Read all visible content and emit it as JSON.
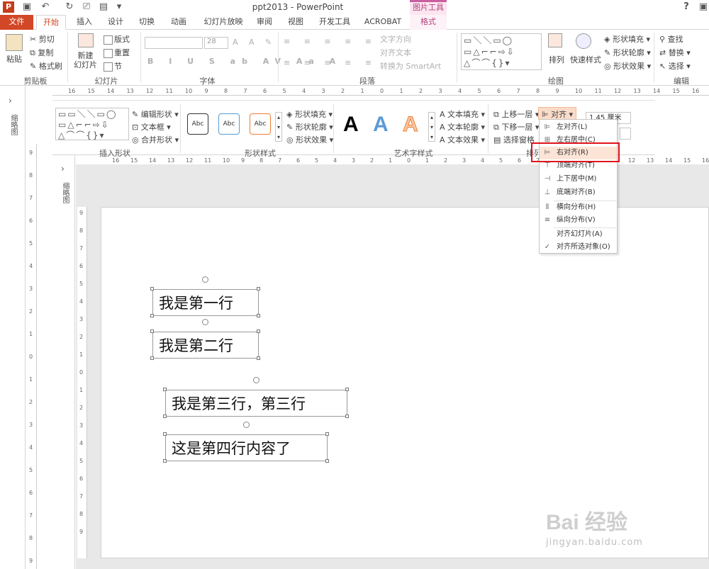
{
  "title_bar": {
    "title": "ppt2013 - PowerPoint",
    "contextual_group": "图片工具",
    "help": "?"
  },
  "tabs": [
    "文件",
    "开始",
    "插入",
    "设计",
    "切换",
    "动画",
    "幻灯片放映",
    "审阅",
    "视图",
    "开发工具",
    "ACROBAT",
    "格式"
  ],
  "ribbon_home": {
    "clipboard": {
      "paste": "粘贴",
      "cut": "剪切",
      "copy": "复制",
      "format_painter": "格式刷",
      "label": "剪贴板"
    },
    "slides": {
      "new_slide": "新建\n幻灯片",
      "layout": "版式",
      "reset": "重置",
      "section": "节",
      "label": "幻灯片"
    },
    "font": {
      "size": "28",
      "label": "字体"
    },
    "paragraph": {
      "text_direction": "文字方向",
      "align_text": "对齐文本",
      "smartart": "转换为 SmartArt",
      "label": "段落"
    },
    "drawing": {
      "arrange": "排列",
      "quick_styles": "快速样式",
      "shape_fill": "形状填充",
      "shape_outline": "形状轮廓",
      "shape_effects": "形状效果",
      "label": "绘图"
    },
    "editing": {
      "find": "查找",
      "replace": "替换",
      "select": "选择",
      "label": "编辑"
    }
  },
  "ribbon_format": {
    "insert_shapes": {
      "edit_shape": "编辑形状",
      "text_box": "文本框",
      "merge_shapes": "合并形状",
      "label": "插入形状"
    },
    "shape_styles": {
      "sample": "Abc",
      "fill": "形状填充",
      "outline": "形状轮廓",
      "effects": "形状效果",
      "label": "形状样式"
    },
    "wordart": {
      "sample": "A",
      "text_fill": "文本填充",
      "text_outline": "文本轮廓",
      "text_effects": "文本效果",
      "label": "艺术字样式"
    },
    "arrange": {
      "bring_forward": "上移一层",
      "send_backward": "下移一层",
      "selection_pane": "选择窗格",
      "align": "对齐",
      "label": "排列"
    },
    "size": {
      "height": "1.45 厘米"
    }
  },
  "align_menu": [
    {
      "label": "左对齐(L)",
      "icon": "align-left-icon"
    },
    {
      "label": "左右居中(C)",
      "icon": "align-center-icon"
    },
    {
      "label": "右对齐(R)",
      "icon": "align-right-icon"
    },
    {
      "label": "顶端对齐(T)",
      "icon": "align-top-icon"
    },
    {
      "label": "上下居中(M)",
      "icon": "align-middle-icon"
    },
    {
      "label": "底端对齐(B)",
      "icon": "align-bottom-icon"
    },
    {
      "label": "横向分布(H)",
      "icon": "distribute-h-icon"
    },
    {
      "label": "纵向分布(V)",
      "icon": "distribute-v-icon"
    },
    {
      "label": "对齐幻灯片(A)",
      "icon": ""
    },
    {
      "label": "对齐所选对象(O)",
      "icon": "check-icon"
    }
  ],
  "ruler_h_labels": [
    "16",
    "15",
    "14",
    "13",
    "12",
    "11",
    "10",
    "9",
    "8",
    "7",
    "6",
    "5",
    "4",
    "3",
    "2",
    "1",
    "0",
    "1",
    "2",
    "3",
    "4",
    "5",
    "6",
    "7",
    "8",
    "9",
    "10",
    "11",
    "12",
    "13",
    "14",
    "15",
    "16"
  ],
  "ruler_v_labels": [
    "9",
    "8",
    "7",
    "6",
    "5",
    "4",
    "3",
    "2",
    "1",
    "0",
    "1",
    "2",
    "3",
    "4",
    "5",
    "6",
    "7",
    "8",
    "9"
  ],
  "thumbnail_label": "缩略图",
  "slide_text": [
    "我是第一行",
    "我是第二行",
    "我是第三行，第三行",
    "这是第四行内容了"
  ],
  "watermark": {
    "logo": "Bai 经验",
    "url": "jingyan.baidu.com"
  },
  "colors": {
    "accent": "#d24726",
    "highlight": "#e0141b",
    "picture_tools": "#c95ea0"
  }
}
